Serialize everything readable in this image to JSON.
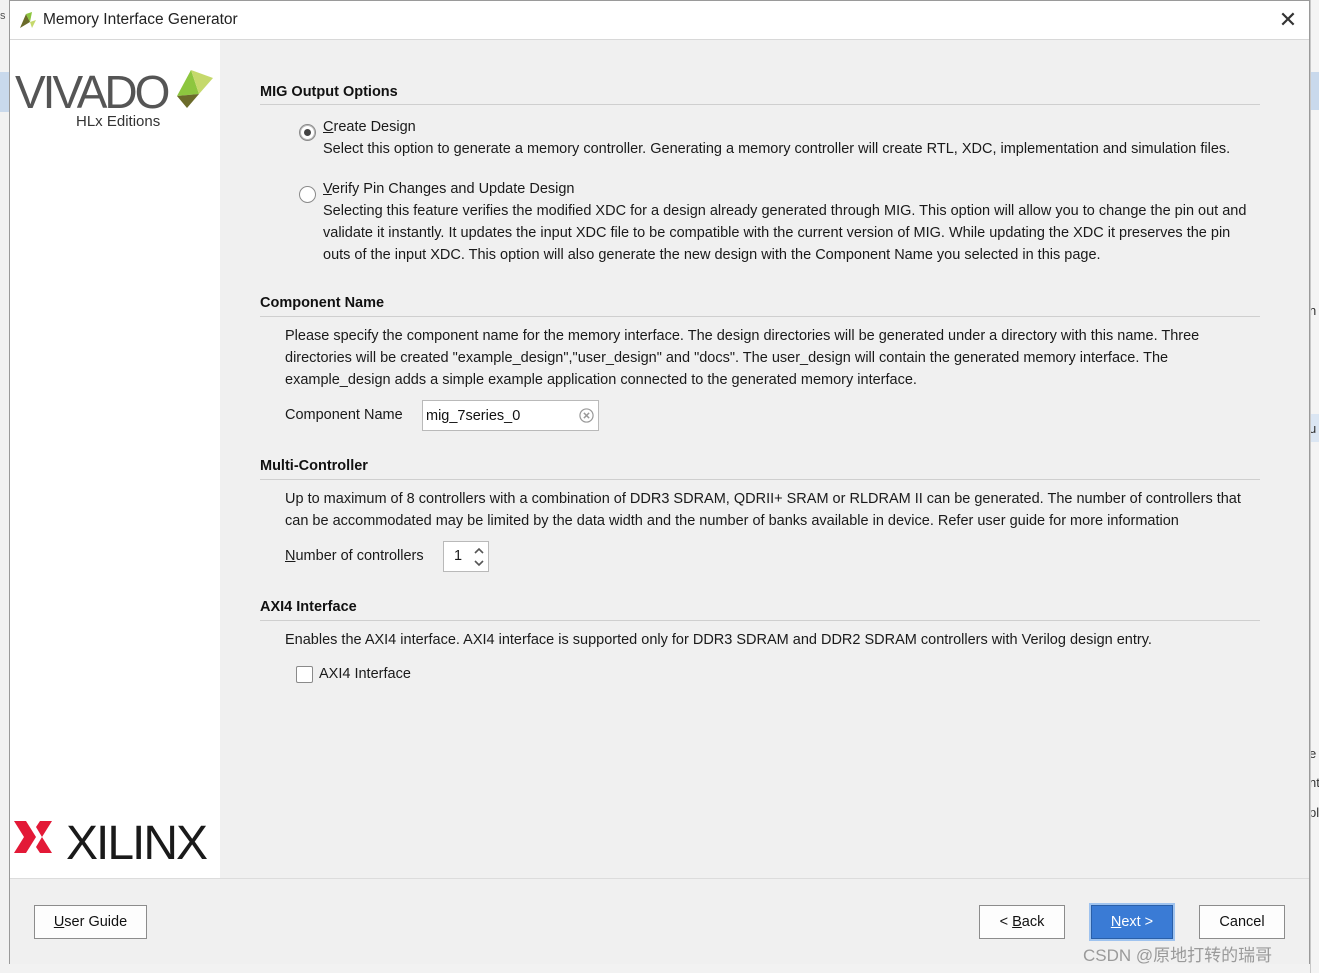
{
  "window": {
    "title": "Memory Interface Generator",
    "close_glyph": "✕"
  },
  "branding": {
    "vivado_wordmark": "VIVADO",
    "vivado_edition": "HLx Editions",
    "xilinx_wordmark": "XILINX",
    "vivado_accent_color": "#8dc63f",
    "xilinx_accent_color": "#e31937"
  },
  "mig_output": {
    "heading": "MIG Output Options",
    "create": {
      "label_mnemonic": "C",
      "label_rest": "reate Design",
      "description": "Select this option to generate a memory controller. Generating a memory controller will create RTL, XDC, implementation and simulation files.",
      "selected": true
    },
    "verify": {
      "label_mnemonic": "V",
      "label_rest": "erify Pin Changes and Update Design",
      "description_lines": [
        "Selecting this feature verifies the modified XDC for a design already generated through MIG. This option will allow you to change the pin out and",
        "validate it instantly. It updates the input XDC file to be compatible with the current version of MIG. While updating the XDC it preserves the pin",
        "outs of the input XDC. This option will also generate the new design with the Component Name you selected in this page."
      ],
      "selected": false
    }
  },
  "component": {
    "heading": "Component Name",
    "description_lines": [
      "Please specify the component name for the memory interface. The design directories will be generated under a directory with this name. Three",
      "directories will be created \"example_design\",\"user_design\" and \"docs\". The user_design will contain the generated memory interface. The",
      "example_design adds a simple example application connected to the generated memory interface."
    ],
    "field_label": "Component Name",
    "field_value": "mig_7series_0"
  },
  "multi_controller": {
    "heading": "Multi-Controller",
    "description_lines": [
      "Up to maximum of 8 controllers with a combination of DDR3 SDRAM, QDRII+ SRAM or RLDRAM II can be generated. The number of controllers that",
      "can be accommodated may be limited by the data width and the number of banks available in device. Refer user guide for more information"
    ],
    "field_label_mnemonic": "N",
    "field_label_rest": "umber of controllers",
    "field_value": "1"
  },
  "axi4": {
    "heading": "AXI4 Interface",
    "description": "Enables the AXI4 interface. AXI4 interface is supported only for DDR3 SDRAM and DDR2 SDRAM controllers with Verilog design entry.",
    "checkbox_label": "AXI4 Interface",
    "checked": false
  },
  "footer": {
    "user_guide_mnemonic": "U",
    "user_guide_rest": "ser Guide",
    "back_prefix": "< ",
    "back_mnemonic": "B",
    "back_rest": "ack",
    "next_mnemonic": "N",
    "next_rest": "ext >",
    "cancel_label": "Cancel",
    "primary_color": "#3a7bd5"
  },
  "background_app": {
    "left_fragment": "s",
    "right_fragments": [
      "n",
      "u",
      "e",
      "nt",
      "pl"
    ]
  },
  "watermark": "CSDN @原地打转的瑞哥"
}
